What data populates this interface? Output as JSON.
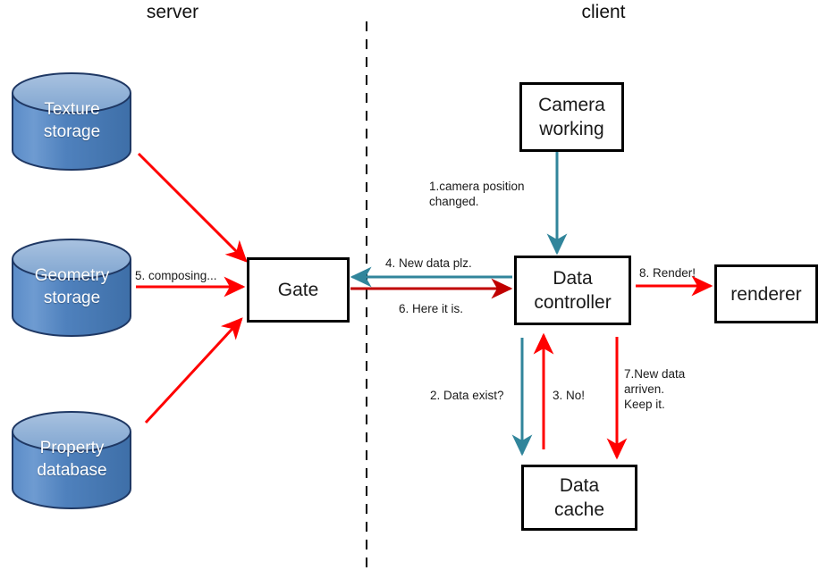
{
  "diagram": {
    "title_server": "server",
    "title_client": "client",
    "colors": {
      "cylinder_fill_top": "#95B3D7",
      "cylinder_fill_body": "#4F81BD",
      "cylinder_stroke": "#1F3864",
      "box_stroke": "#000000",
      "arrow_blue": "#31859B",
      "arrow_red_bright": "#FF0000",
      "arrow_red_dark": "#C00000",
      "divider": "#000000"
    }
  },
  "nodes": {
    "texture_storage": "Texture\nstorage",
    "geometry_storage": "Geometry\nstorage",
    "property_database": "Property\ndatabase",
    "gate": "Gate",
    "camera_working": "Camera\nworking",
    "data_controller": "Data\ncontroller",
    "renderer": "renderer",
    "data_cache": "Data\ncache"
  },
  "edges": {
    "step1": "1.camera position\nchanged.",
    "step2": "2. Data exist?",
    "step3": "3.  No!",
    "step4": "4.  New data plz.",
    "step5": "5. composing...",
    "step6": "6. Here it is.",
    "step7": "7.New data\narriven.\nKeep it.",
    "step8": "8. Render!"
  }
}
